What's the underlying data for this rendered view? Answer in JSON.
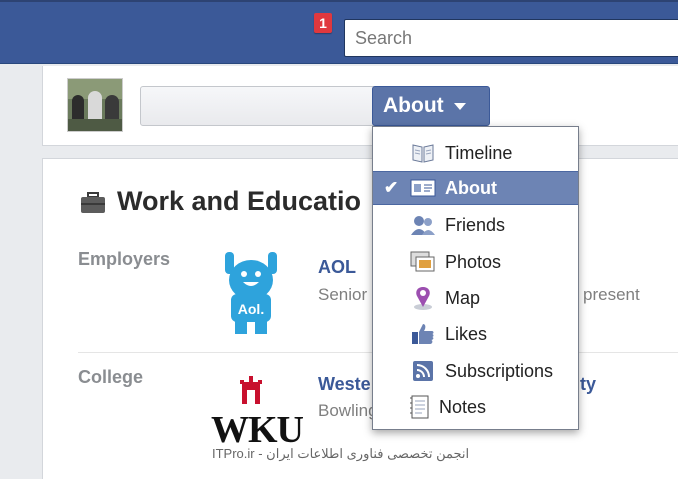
{
  "header": {
    "notification_count": "1",
    "search_placeholder": "Search"
  },
  "profile_nav": {
    "active_tab": "About"
  },
  "dropdown": {
    "items": [
      {
        "label": "Timeline",
        "icon": "timeline-book-icon",
        "selected": false
      },
      {
        "label": "About",
        "icon": "about-id-card-icon",
        "selected": true
      },
      {
        "label": "Friends",
        "icon": "friends-icon",
        "selected": false
      },
      {
        "label": "Photos",
        "icon": "photos-icon",
        "selected": false
      },
      {
        "label": "Map",
        "icon": "map-pin-icon",
        "selected": false
      },
      {
        "label": "Likes",
        "icon": "like-thumb-icon",
        "selected": false
      },
      {
        "label": "Subscriptions",
        "icon": "rss-icon",
        "selected": false
      },
      {
        "label": "Notes",
        "icon": "notes-icon",
        "selected": false
      }
    ]
  },
  "work_education": {
    "title": "Work and Educatio",
    "employers_label": "Employers",
    "employer": {
      "name": "AOL",
      "role_left": "Senior",
      "role_right": "present"
    },
    "college_label": "College",
    "college": {
      "name": "Weste",
      "name_right": "ty",
      "location": "Bowling",
      "logo_text": "WKU"
    }
  },
  "watermark": "ITPro.ir - انجمن تخصصی فناوری اطلاعات ایران",
  "colors": {
    "brand_blue": "#3b5998",
    "selected_item": "#6d84b4",
    "badge_red": "#e0383e"
  }
}
